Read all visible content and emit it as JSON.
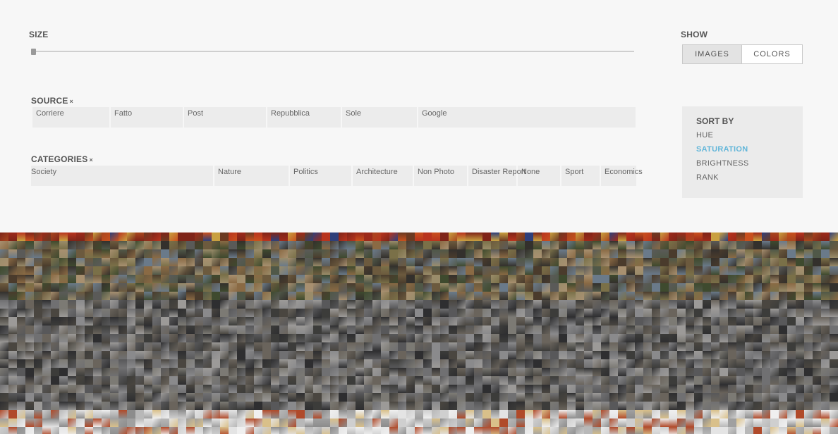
{
  "size": {
    "label": "SIZE"
  },
  "show": {
    "label": "SHOW",
    "options": [
      {
        "label": "IMAGES",
        "active": true
      },
      {
        "label": "COLORS",
        "active": false
      }
    ]
  },
  "source": {
    "label": "SOURCE",
    "clear": "×",
    "items": [
      "Corriere",
      "Fatto",
      "Post",
      "Repubblica",
      "Sole",
      "Google"
    ]
  },
  "categories": {
    "label": "CATEGORIES",
    "clear": "×",
    "items": [
      "Society",
      "Nature",
      "Politics",
      "Architecture",
      "Non Photo",
      "Disaster Report",
      "None",
      "Sport",
      "Economics"
    ]
  },
  "sort": {
    "title": "SORT BY",
    "options": [
      {
        "label": "HUE",
        "selected": false
      },
      {
        "label": "SATURATION",
        "selected": true
      },
      {
        "label": "BRIGHTNESS",
        "selected": false
      },
      {
        "label": "RANK",
        "selected": false
      }
    ]
  },
  "mosaic": {
    "palette_top": [
      "#b8341e",
      "#9c2a1a",
      "#c8501e",
      "#7e2418",
      "#a8471f",
      "#6b3a22",
      "#2f3f7a",
      "#c9a040"
    ],
    "palette_mid": [
      "#4a3b2c",
      "#6c5a3e",
      "#7a7048",
      "#3e4a2e",
      "#8a6a44",
      "#5a5a58",
      "#9a8c6a",
      "#33302c",
      "#6a7a8a",
      "#a89070",
      "#505848"
    ],
    "palette_low": [
      "#3c3c3a",
      "#58585a",
      "#707072",
      "#8a8a8c",
      "#4a4640",
      "#6a645c",
      "#9c9a98",
      "#2e2e30",
      "#7c7a74"
    ],
    "palette_bottom": [
      "#b8b8b8",
      "#cfcfcf",
      "#e4e4e4",
      "#8c8c8c",
      "#d9c08a",
      "#a0a0a0",
      "#f0f0f0",
      "#b04a2a"
    ]
  }
}
